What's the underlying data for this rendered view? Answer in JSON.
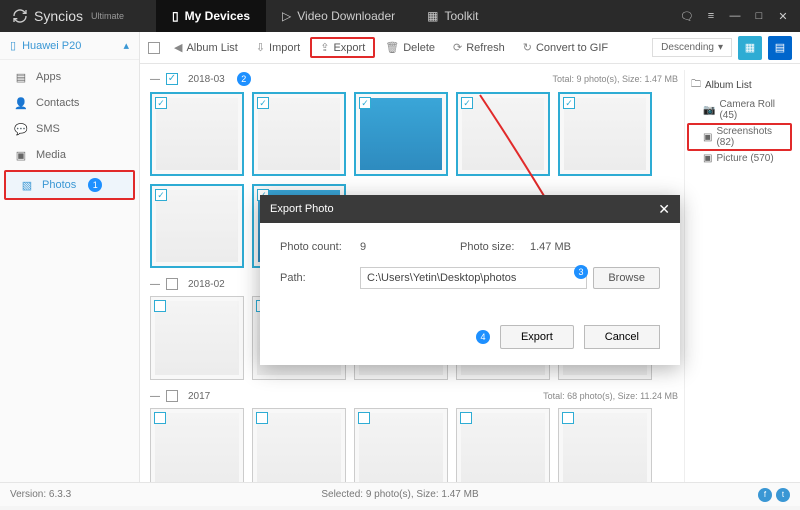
{
  "brand": {
    "name": "Syncios",
    "edition": "Ultimate"
  },
  "nav": {
    "devices": "My Devices",
    "video": "Video Downloader",
    "toolkit": "Toolkit"
  },
  "device": {
    "name": "Huawei P20"
  },
  "sidebar": {
    "apps": "Apps",
    "contacts": "Contacts",
    "sms": "SMS",
    "media": "Media",
    "photos": "Photos",
    "photos_badge": "1"
  },
  "toolbar": {
    "albumlist": "Album List",
    "import": "Import",
    "export": "Export",
    "delete": "Delete",
    "refresh": "Refresh",
    "gif": "Convert to GIF",
    "sort": "Descending"
  },
  "sections": {
    "s1": {
      "label": "2018-03",
      "info": "Total: 9 photo(s), Size: 1.47 MB",
      "badge": "2"
    },
    "s2": {
      "label": "2018-02"
    },
    "s3": {
      "label": "2017",
      "info": "Total: 68 photo(s), Size: 11.24 MB"
    }
  },
  "albums": {
    "title": "Album List",
    "camera": "Camera Roll (45)",
    "screenshots": "Screenshots (82)",
    "picture": "Picture (570)"
  },
  "dialog": {
    "title": "Export Photo",
    "count_lbl": "Photo count:",
    "count": "9",
    "size_lbl": "Photo size:",
    "size": "1.47 MB",
    "path_lbl": "Path:",
    "path": "C:\\Users\\Yetin\\Desktop\\photos",
    "browse": "Browse",
    "export": "Export",
    "cancel": "Cancel",
    "badge3": "3",
    "badge4": "4"
  },
  "status": {
    "version": "Version: 6.3.3",
    "selected": "Selected: 9 photo(s), Size: 1.47 MB"
  }
}
